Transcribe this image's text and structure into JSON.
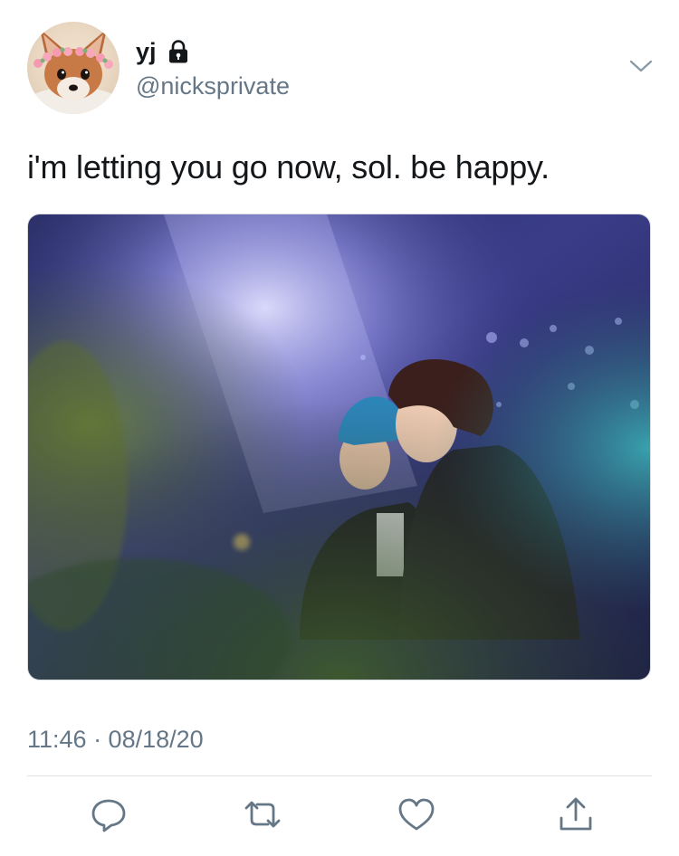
{
  "user": {
    "display_name": "yj",
    "handle": "@nicksprivate",
    "protected": true
  },
  "tweet": {
    "text": "i'm letting you go now, sol. be happy.",
    "timestamp": "11:46 · 08/18/20"
  },
  "icons": {
    "lock": "lock-icon",
    "menu": "chevron-down-icon",
    "reply": "reply-icon",
    "retweet": "retweet-icon",
    "like": "heart-icon",
    "share": "share-icon"
  },
  "colors": {
    "text_primary": "#14171a",
    "text_secondary": "#657786",
    "icon_gray": "#657786",
    "divider": "#dfe3e7"
  }
}
